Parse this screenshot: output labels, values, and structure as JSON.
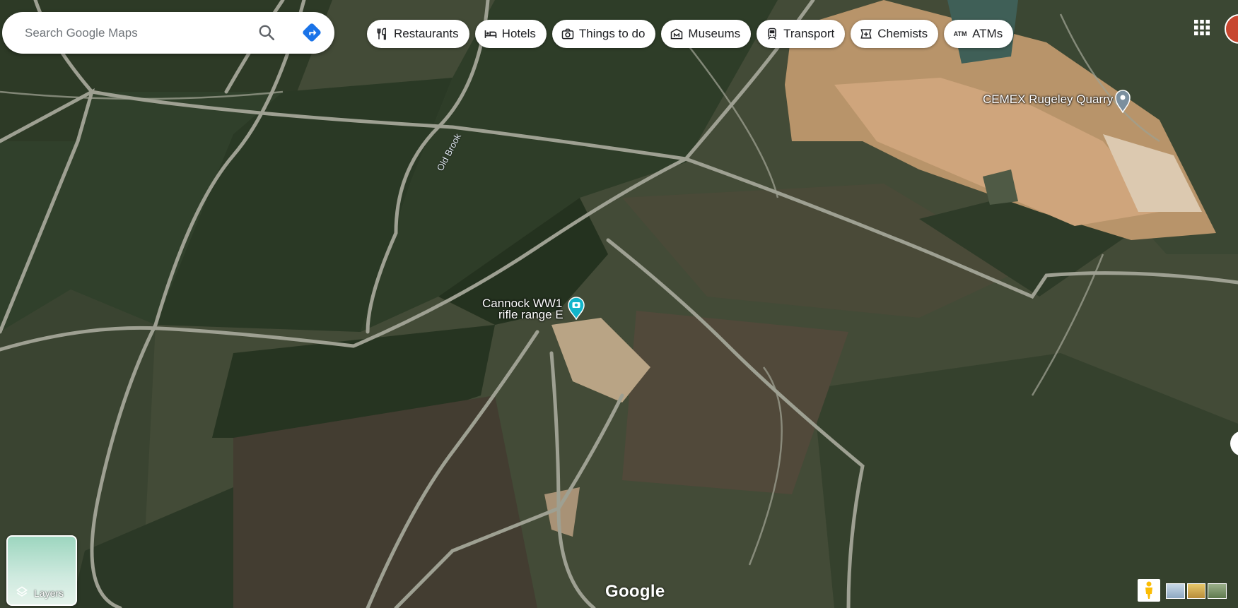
{
  "search": {
    "placeholder": "Search Google Maps",
    "search_icon": "search-icon",
    "directions_icon": "directions-icon"
  },
  "chips": [
    {
      "label": "Restaurants",
      "icon": "restaurant-icon"
    },
    {
      "label": "Hotels",
      "icon": "hotel-icon"
    },
    {
      "label": "Things to do",
      "icon": "camera-icon"
    },
    {
      "label": "Museums",
      "icon": "museum-icon"
    },
    {
      "label": "Transport",
      "icon": "transit-icon"
    },
    {
      "label": "Chemists",
      "icon": "pharmacy-icon"
    },
    {
      "label": "ATMs",
      "icon": "atm-icon"
    }
  ],
  "map": {
    "places": [
      {
        "name_line1": "Cannock WW1",
        "name_line2": "rifle range E",
        "icon": "camera-pin-icon"
      },
      {
        "name": "CEMEX Rugeley Quarry",
        "icon": "place-pin-icon"
      }
    ],
    "road_label": "Old Brook",
    "logo": "Google",
    "colors": {
      "pin_teal": "#12b5cb",
      "pin_grey": "#7b8f9e"
    }
  },
  "controls": {
    "layers_label": "Layers"
  }
}
